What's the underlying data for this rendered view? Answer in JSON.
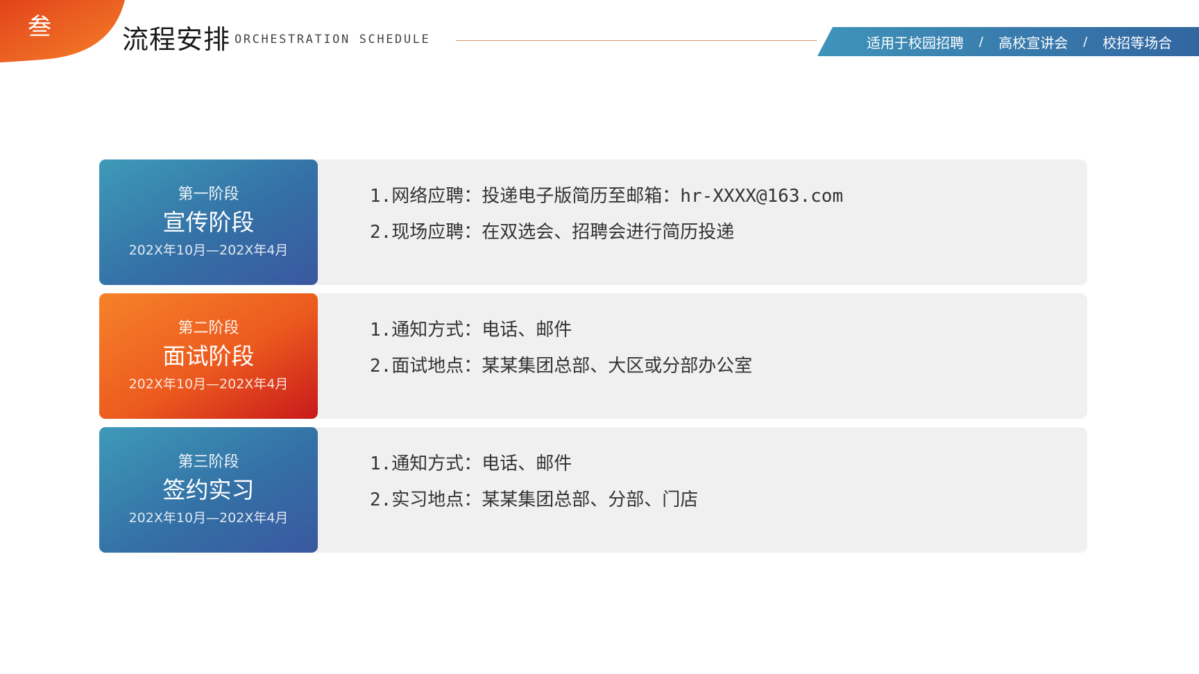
{
  "header": {
    "badge": "叁",
    "title": "流程安排",
    "subtitle": "ORCHESTRATION SCHEDULE",
    "scenes": [
      "适用于校园招聘",
      "高校宣讲会",
      "校招等场合"
    ],
    "scene_separator": "/",
    "accent_orange": "#ea5a1c",
    "accent_blue": "#3476a6"
  },
  "stages": [
    {
      "label": "第一阶段",
      "title": "宣传阶段",
      "dates": "202X年10月—202X年4月",
      "color": "blue",
      "items": [
        "1.网络应聘：投递电子版简历至邮箱：hr-XXXX@163.com",
        "2.现场应聘：在双选会、招聘会进行简历投递"
      ]
    },
    {
      "label": "第二阶段",
      "title": "面试阶段",
      "dates": "202X年10月—202X年4月",
      "color": "orange",
      "items": [
        "1.通知方式：电话、邮件",
        "2.面试地点：某某集团总部、大区或分部办公室"
      ]
    },
    {
      "label": "第三阶段",
      "title": "签约实习",
      "dates": "202X年10月—202X年4月",
      "color": "blue",
      "items": [
        "1.通知方式：电话、邮件",
        "2.实习地点：某某集团总部、分部、门店"
      ]
    }
  ]
}
